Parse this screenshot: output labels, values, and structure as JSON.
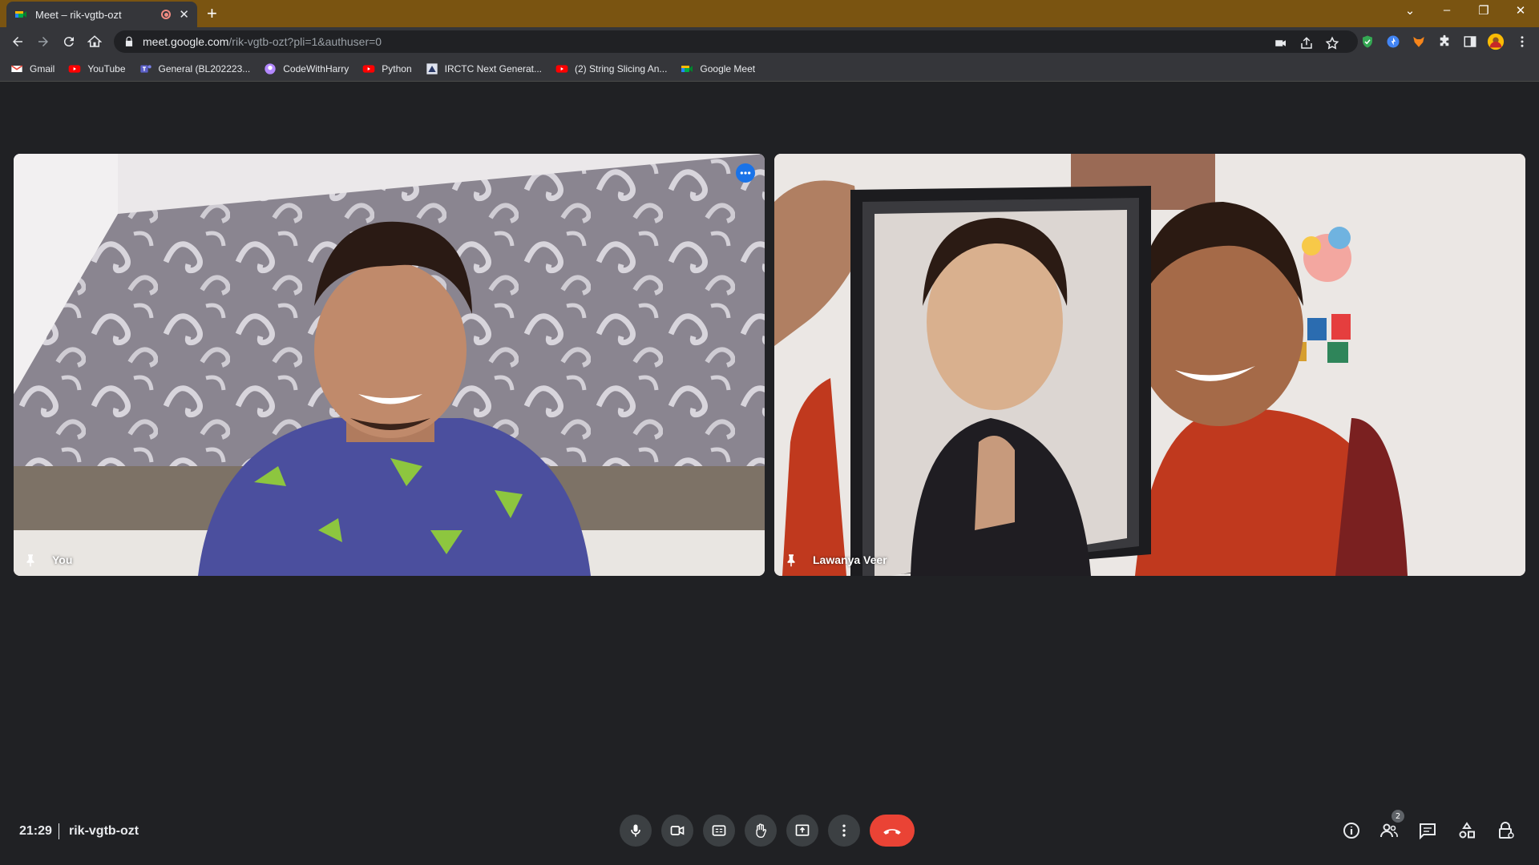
{
  "browser": {
    "tab_title": "Meet – rik-vgtb-ozt",
    "tab_close": "✕",
    "new_tab": "+",
    "window_controls": {
      "tab_search": "⌄",
      "minimize": "–",
      "restore": "❐",
      "close": "✕"
    },
    "url_host": "meet.google.com",
    "url_path": "/rik-vgtb-ozt?pli=1&authuser=0"
  },
  "bookmarks": [
    {
      "label": "Gmail",
      "icon": "gmail-icon",
      "color": "#ea4335"
    },
    {
      "label": "YouTube",
      "icon": "youtube-icon",
      "color": "#ff0000"
    },
    {
      "label": "General (BL202223...",
      "icon": "teams-icon",
      "color": "#5b5fc7"
    },
    {
      "label": "CodeWithHarry",
      "icon": "codewithharry-icon",
      "color": "#b388ff"
    },
    {
      "label": "Python",
      "icon": "youtube-icon",
      "color": "#ff0000"
    },
    {
      "label": "IRCTC Next Generat...",
      "icon": "irctc-icon",
      "color": "#2b3a67"
    },
    {
      "label": "(2) String Slicing An...",
      "icon": "youtube-icon",
      "color": "#ff0000"
    },
    {
      "label": "Google Meet",
      "icon": "meet-icon",
      "color": "#00832d"
    }
  ],
  "participants": [
    {
      "name": "You"
    },
    {
      "name": "Lawanya Veer"
    }
  ],
  "meeting": {
    "time": "21:29",
    "code": "rik-vgtb-ozt",
    "participant_count": "2"
  },
  "colors": {
    "stage_bg": "#202124",
    "end_call": "#ea4335",
    "accent": "#1a73e8",
    "titlebar": "#7a5411"
  }
}
